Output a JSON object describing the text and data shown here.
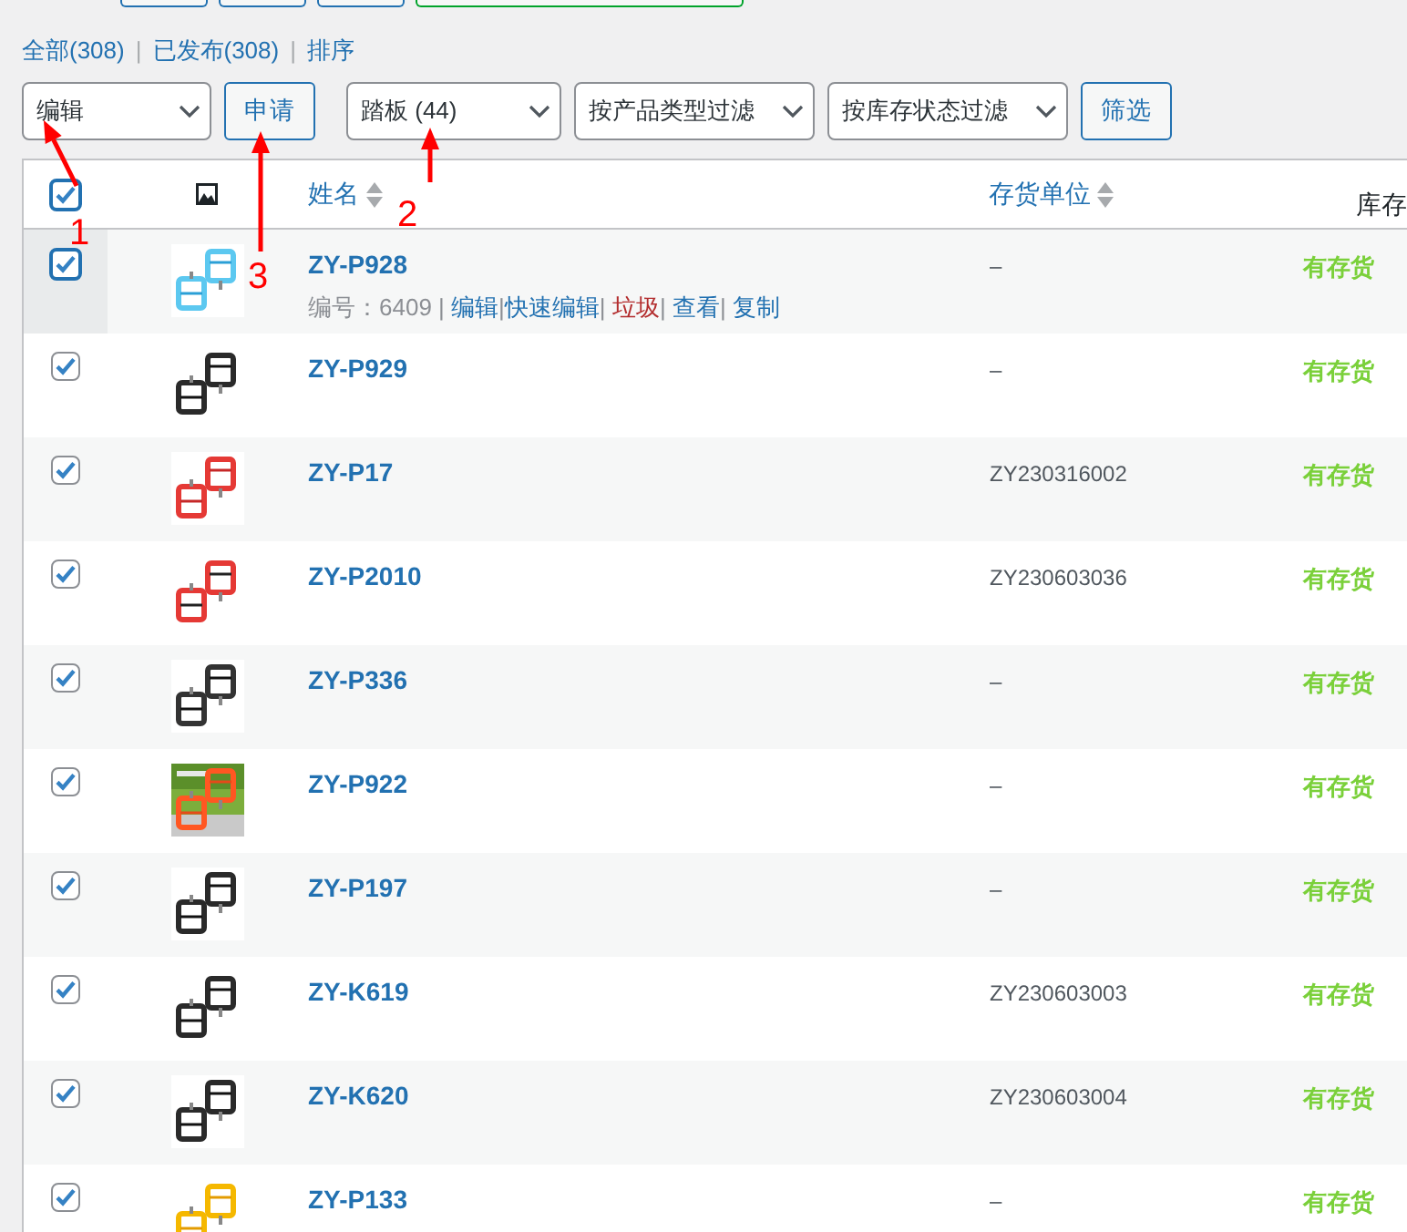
{
  "views": [
    {
      "label": "全部",
      "count": "(308)"
    },
    {
      "label": "已发布",
      "count": "(308)"
    },
    {
      "label": "排序"
    }
  ],
  "view_separator": "|",
  "bulk_action": {
    "value": "编辑"
  },
  "apply_button": "申请",
  "filters": [
    {
      "value": "踏板 (44)"
    },
    {
      "value": "按产品类型过滤"
    },
    {
      "value": "按库存状态过滤"
    }
  ],
  "filter_button": "筛选",
  "header": {
    "checked": true,
    "columns": [
      {
        "label": "姓名",
        "sortable": true
      },
      {
        "label": "存货单位",
        "sortable": true
      },
      {
        "label": "库存",
        "sortable": false
      }
    ]
  },
  "rows": [
    {
      "name": "ZY-P928",
      "sku": "–",
      "stock": "有存货",
      "checked": true,
      "highlighted": true,
      "meta": "编号：6409 |",
      "actions": [
        {
          "label": "编辑",
          "kind": "link"
        },
        {
          "label": "快速编辑",
          "kind": "link"
        },
        {
          "label": "垃圾",
          "kind": "trash"
        },
        {
          "label": "查看",
          "kind": "link"
        },
        {
          "label": "复制",
          "kind": "link"
        }
      ]
    },
    {
      "name": "ZY-P929",
      "sku": "–",
      "stock": "有存货",
      "checked": true,
      "highlighted": false
    },
    {
      "name": "ZY-P17",
      "sku": "ZY230316002",
      "stock": "有存货",
      "checked": true,
      "highlighted": false
    },
    {
      "name": "ZY-P2010",
      "sku": "ZY230603036",
      "stock": "有存货",
      "checked": true,
      "highlighted": false
    },
    {
      "name": "ZY-P336",
      "sku": "–",
      "stock": "有存货",
      "checked": true,
      "highlighted": false
    },
    {
      "name": "ZY-P922",
      "sku": "–",
      "stock": "有存货",
      "checked": true,
      "highlighted": false
    },
    {
      "name": "ZY-P197",
      "sku": "–",
      "stock": "有存货",
      "checked": true,
      "highlighted": false
    },
    {
      "name": "ZY-K619",
      "sku": "ZY230603003",
      "stock": "有存货",
      "checked": true,
      "highlighted": false
    },
    {
      "name": "ZY-K620",
      "sku": "ZY230603004",
      "stock": "有存货",
      "checked": true,
      "highlighted": false
    },
    {
      "name": "ZY-P133",
      "sku": "–",
      "stock": "有存货",
      "checked": true,
      "highlighted": false
    }
  ],
  "action_separator": "|",
  "annotations": [
    {
      "label": "1"
    },
    {
      "label": "2"
    },
    {
      "label": "3"
    }
  ]
}
